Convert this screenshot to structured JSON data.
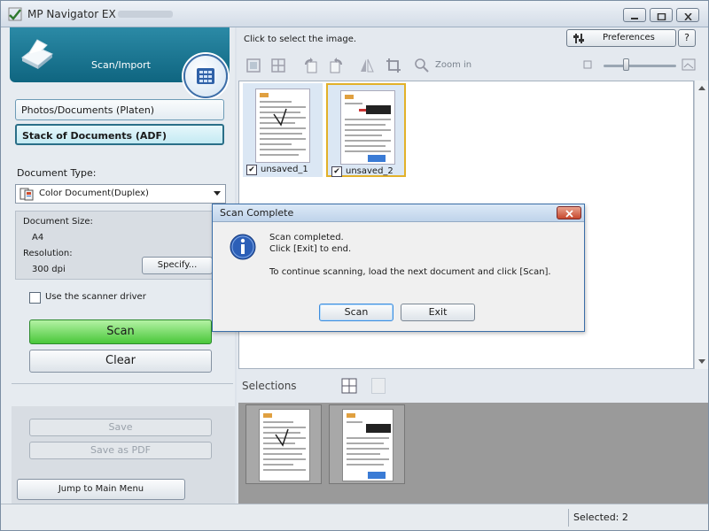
{
  "window": {
    "title": "MP Navigator EX"
  },
  "left_panel": {
    "header_label": "Scan/Import",
    "modes": {
      "photo": "Photos/Documents (Platen)",
      "stack": "Stack of Documents (ADF)"
    },
    "document_type_label": "Document Type:",
    "document_type_value": "Color Document(Duplex)",
    "document_size_label": "Document Size:",
    "document_size_value": "A4",
    "resolution_label": "Resolution:",
    "resolution_value": "300 dpi",
    "specify_label": "Specify...",
    "scanner_driver_label": "Use the scanner driver",
    "scan_label": "Scan",
    "clear_label": "Clear",
    "save_label": "Save",
    "save_pdf_label": "Save as PDF",
    "jump_label": "Jump to Main Menu"
  },
  "right_panel": {
    "instruction": "Click to select the image.",
    "preferences_label": "Preferences",
    "help_label": "?",
    "zoom_label": "Zoom in",
    "thumbnails": [
      {
        "name": "unsaved_1",
        "checked": true,
        "selected": false
      },
      {
        "name": "unsaved_2",
        "checked": true,
        "selected": true
      }
    ],
    "selections_label": "Selections"
  },
  "status": {
    "selected_text": "Selected: 2"
  },
  "dialog": {
    "title": "Scan Complete",
    "line1": "Scan completed.",
    "line2": "Click [Exit] to end.",
    "line3": "To continue scanning, load the next document and click [Scan].",
    "scan_label": "Scan",
    "exit_label": "Exit"
  },
  "colors": {
    "accent_teal": "#0f6580",
    "scan_green": "#49c73a",
    "selection_gold": "#e2b12a"
  },
  "icons": [
    "app-icon",
    "minimize-icon",
    "maximize-icon",
    "close-icon",
    "scanner-icon",
    "main-menu-icon",
    "document-icon",
    "dropdown-arrow-icon",
    "preferences-icon",
    "info-icon",
    "checkmark-icon",
    "grid-icon"
  ]
}
